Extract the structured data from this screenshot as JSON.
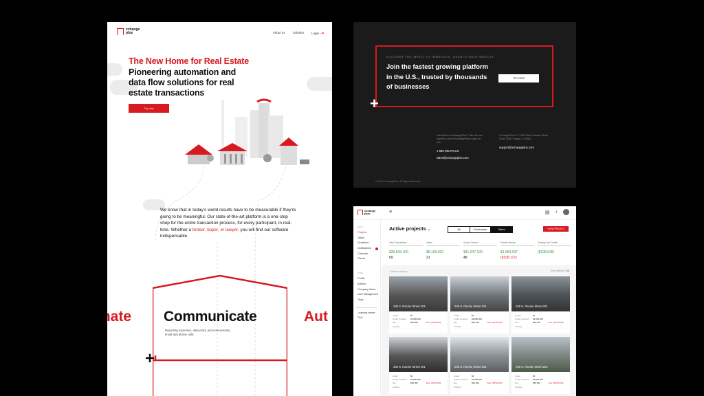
{
  "landing": {
    "brand": "xchange plus",
    "nav": {
      "about": "About us",
      "solution": "Solution",
      "login": "Login"
    },
    "hero_red": "The New Home for Real Estate",
    "hero_black": "Pioneering automation and data flow solutions for real estate transactions",
    "try_button": "Try now",
    "intro_before": "We know that in today's world results have to be measurable if they're going to be meaningful. Our state-of-the-art platform is a one-stop shop for the entire transaction process, for every participant, in real-time. Whether a ",
    "intro_red": "broker, buyer, or lawyer,",
    "intro_after": " you will find our software indispensable.",
    "slider_left": "mate",
    "slider_center": "Communicate",
    "slider_right": "Aut",
    "slider_desc": "Reporting expenses, data entry, and unnecessary email and phone calls"
  },
  "dark": {
    "kicker": "DISCOVER THE IMPACT OF IMMEDIATE, QUANTIFIABLE RESULTS.",
    "headline": "Join the fastest growing platform in the U.S., trusted by thousands of businesses",
    "try_button": "TRY NOW",
    "col1_text": "Interested in eXchangePlus? Talk with our experts to see if XchangePlus is right for you.",
    "phone": "1-888-WEXPLUS",
    "sales_email": "sales@xchangeplus.com",
    "col2_text": "XchangePlus LLC 1006 North Halsted Street Suite 2028 Chicago, IL 60642",
    "support_email": "support@xchangeplus.com",
    "copyright": "© 2019 eXchangePlus. All Rights Reserved."
  },
  "dashboard": {
    "brand": "xchange plus",
    "sidebar_section_main": "MAIN",
    "sidebar_main": [
      "Projects",
      "Tasks",
      "Deadlines",
      "Notifications",
      "Calendar",
      "Clients"
    ],
    "sidebar_section_user": "USER",
    "sidebar_user": [
      "Profile",
      "Actions",
      "Company Users",
      "User Management",
      "Tools"
    ],
    "sidebar_extra": [
      "Learning center",
      "FAQ"
    ],
    "title": "Active projects",
    "tabs": [
      "All",
      "Purchases",
      "Sales"
    ],
    "new_project": "+ NEW PROJECT",
    "stats": [
      {
        "label": "Total Transactions",
        "v1": "$39,603,100",
        "v2": "69",
        "v2_red": false
      },
      {
        "label": "Listed",
        "v1": "$8,106,000",
        "v2": "21",
        "v2_red": false
      },
      {
        "label": "Under Contract",
        "v1": "$31,547,100",
        "v2": "48",
        "v2_red": false
      },
      {
        "label": "Earnest Money",
        "v1": "$1,964,037",
        "v2": "($108,117)",
        "v2_red": true
      },
      {
        "label": "Closing Cost Credits",
        "v1": "($108,536)",
        "v2": "",
        "v2_red": false
      }
    ],
    "search_placeholder": "Search projects",
    "filter_label": "Sort settings",
    "cards": [
      {
        "address": "236 S. Racine Street 201",
        "due": "Due: ($750,000)"
      },
      {
        "address": "236 S. Racine Street 201",
        "due": "Due: ($750,000)"
      },
      {
        "address": "236 S. Racine Street 201",
        "due": "Due: ($750,000)"
      },
      {
        "address": "236 S. Racine Street 201",
        "due": "Due: ($750,000)"
      },
      {
        "address": "236 S. Racine Street 201",
        "due": "Due: ($750,000)"
      },
      {
        "address": "236 S. Racine Street 201",
        "due": "Due: ($750,000)"
      }
    ],
    "card_labels": [
      "Listed",
      "Under Contract",
      "Net",
      "Closing"
    ],
    "card_values": [
      "$0",
      "$3,800,000",
      "$50,000"
    ]
  },
  "colors": {
    "accent": "#d71920",
    "dark_bg": "#1b1b1b",
    "positive": "#3c9a3c"
  }
}
